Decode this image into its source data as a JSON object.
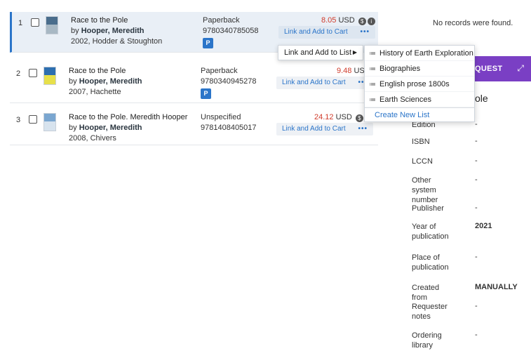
{
  "results": [
    {
      "num": "1",
      "title": "Race to the Pole",
      "by": "by",
      "author": "Hooper, Meredith",
      "pubinfo": "2002, Hodder & Stoughton",
      "format": "Paperback",
      "isbn": "9780340785058",
      "badge": "P",
      "price": "8.05",
      "currency": "USD",
      "cart_label": "Link and Add to Cart",
      "more": "•••",
      "thumb_colors": [
        "#4a6d8c",
        "#a8b8c4"
      ]
    },
    {
      "num": "2",
      "title": "Race to the Pole",
      "by": "by",
      "author": "Hooper, Meredith",
      "pubinfo": "2007, Hachette",
      "format": "Paperback",
      "isbn": "9780340945278",
      "badge": "P",
      "price": "9.48",
      "currency": "USD",
      "cart_label": "Link and Add to Cart",
      "more": "•••",
      "thumb_colors": [
        "#2d6fb0",
        "#e7e04a"
      ]
    },
    {
      "num": "3",
      "title": "Race to the Pole. Meredith Hooper",
      "by": "by",
      "author": "Hooper, Meredith",
      "pubinfo": "2008, Chivers",
      "format": "Unspecified",
      "isbn": "9781408405017",
      "price": "24.12",
      "currency": "USD",
      "cart_label": "Link and Add to Cart",
      "more": "•••",
      "thumb_colors": [
        "#7aa6d0",
        "#d7e3ee"
      ]
    }
  ],
  "menu": {
    "primary_label": "Link and Add to List",
    "caret": "▶",
    "list_icon": "≔",
    "lists": [
      "History of Earth Exploration",
      "Biographies",
      "English prose 1800s",
      "Earth Sciences"
    ],
    "create_label": "Create New List"
  },
  "panel": {
    "no_records": "No records were found.",
    "header_text": "QUEST",
    "expand_icon": "⤢",
    "title": "ole",
    "details": [
      {
        "label": "Edition",
        "value": "-"
      },
      {
        "label": "ISBN",
        "value": "-"
      },
      {
        "label": "LCCN",
        "value": "-"
      },
      {
        "label": "Other system number",
        "value": "-"
      },
      {
        "label": "Publisher",
        "value": "-"
      },
      {
        "label": "Year of publication",
        "value": "2021"
      },
      {
        "label": "Place of publication",
        "value": "-"
      },
      {
        "label": "Created from",
        "value": "MANUALLY"
      },
      {
        "label": "Requester notes",
        "value": "-"
      },
      {
        "label": "Ordering library",
        "value": "-"
      }
    ]
  },
  "colors": {
    "accent": "#2b75c9",
    "price_red": "#d03b2b",
    "purple": "#7a3fc4",
    "selected_bg": "#e9eff6"
  },
  "icons": {
    "price_icon": "currency-info-icon"
  }
}
